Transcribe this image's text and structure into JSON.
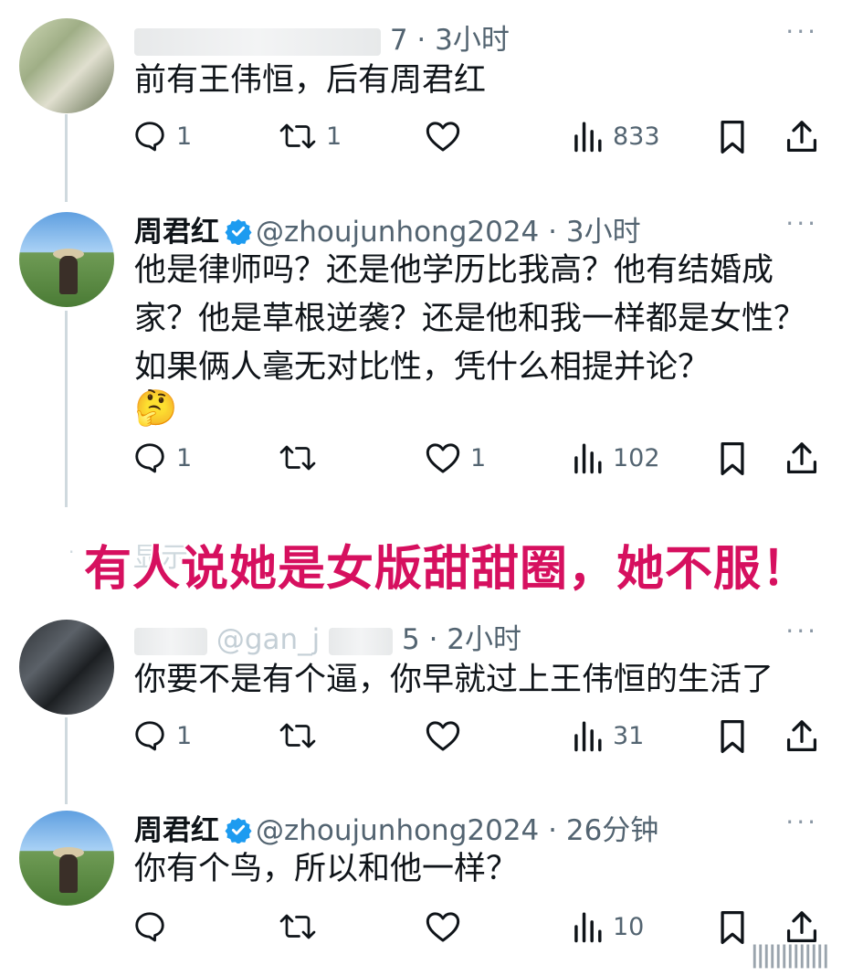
{
  "tweets": [
    {
      "name": "",
      "handle": "",
      "time": "7 · 3小时",
      "text": "前有王伟恒，后有周君红",
      "avatar": "blurred-avatar",
      "stats": {
        "replies": "1",
        "retweets": "1",
        "likes": "",
        "views": "833"
      }
    },
    {
      "name": "周君红",
      "handle": "@zhoujunhong2024",
      "time": "· 3小时",
      "text": "他是律师吗？还是他学历比我高？他有结婚成家？他是草根逆袭？还是他和我一样都是女性？如果俩人毫无对比性，凭什么相提并论？",
      "emoji": "🤔",
      "avatar": "field-photo-avatar",
      "stats": {
        "replies": "1",
        "retweets": "",
        "likes": "1",
        "views": "102"
      }
    },
    {
      "name": "",
      "handle": "@gan_j",
      "time": "5 · 2小时",
      "text": "你要不是有个逼，你早就过上王伟恒的生活了",
      "avatar": "blurred-dark-avatar",
      "stats": {
        "replies": "1",
        "retweets": "",
        "likes": "",
        "views": "31"
      }
    },
    {
      "name": "周君红",
      "handle": "@zhoujunhong2024",
      "time": "· 26分钟",
      "text": "你有个鸟，所以和他一样？",
      "avatar": "field-photo-avatar",
      "stats": {
        "replies": "",
        "retweets": "",
        "likes": "",
        "views": "10"
      }
    }
  ],
  "banner": "有人说她是女版甜甜圈，她不服！",
  "show_more": "显示",
  "more_label": "···",
  "colors": {
    "verified": "#1d9bf0",
    "banner": "#d6105f",
    "text": "#0f1419",
    "muted": "#536471"
  }
}
